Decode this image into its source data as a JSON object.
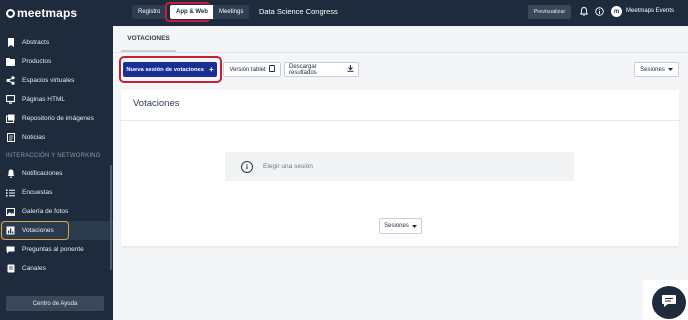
{
  "brand": {
    "name": "meetmaps"
  },
  "sidebar": {
    "items_top": [
      {
        "label": "Abstracts",
        "icon": "bookmark-icon"
      },
      {
        "label": "Productos",
        "icon": "folder-icon"
      },
      {
        "label": "Espacios virtuales",
        "icon": "share-icon"
      },
      {
        "label": "Páginas HTML",
        "icon": "monitor-icon"
      },
      {
        "label": "Repositorio de imágenes",
        "icon": "images-icon"
      },
      {
        "label": "Noticias",
        "icon": "document-icon"
      }
    ],
    "section_label": "INTERACCIÓN Y NETWORKING",
    "items_bottom": [
      {
        "label": "Notificaciones",
        "icon": "bell-icon"
      },
      {
        "label": "Encuestas",
        "icon": "list-icon"
      },
      {
        "label": "Galería de fotos",
        "icon": "gallery-icon"
      },
      {
        "label": "Votaciones",
        "icon": "chart-icon",
        "active": true
      },
      {
        "label": "Preguntas al ponente",
        "icon": "question-icon"
      },
      {
        "label": "Canales",
        "icon": "channel-icon"
      }
    ],
    "help_label": "Centro de Ayuda"
  },
  "topbar": {
    "tabs": [
      "Registro",
      "App & Web",
      "Meetings"
    ],
    "selected_tab": "App & Web",
    "event_name": "Data Science Congress",
    "preview_label": "Previsualizar",
    "user_name": "Meetmaps Events"
  },
  "main": {
    "tab_label": "VOTACIONES",
    "new_session_label": "Nueva sesión de votaciones",
    "tablet_label": "Versión tablet",
    "download_label": "Descargar resultados",
    "sessions_dropdown_label": "Sesiones",
    "card_title": "Votaciones",
    "empty_message": "Elegir una sesión",
    "card_sessions_label": "Sesiones"
  },
  "colors": {
    "sidebar_bg": "#1e2b3c",
    "primary": "#1a2f95",
    "highlight_red": "#c21f3a",
    "highlight_gold": "#d9a442"
  }
}
